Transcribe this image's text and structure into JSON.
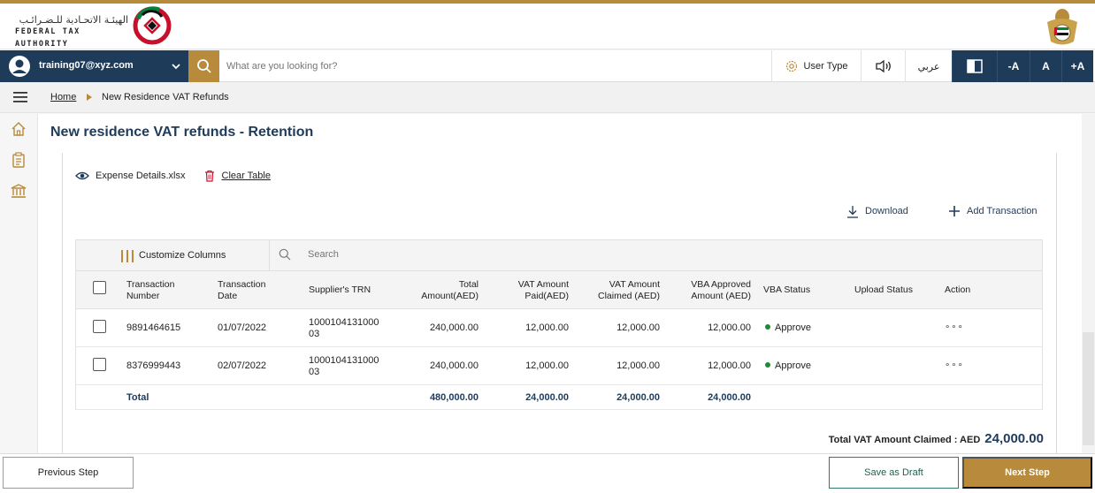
{
  "header": {
    "logo_ar": "الهيئـة الاتحـادية للـضـرائـب",
    "logo_en": "FEDERAL TAX AUTHORITY",
    "logo_icon": "fta-logo-mark",
    "emblem_icon": "uae-emblem"
  },
  "toolbar": {
    "user_email": "training07@xyz.com",
    "search_placeholder": "What are you looking for?",
    "user_type_label": "User Type",
    "language_label": "عربي",
    "font_decrease": "-A",
    "font_normal": "A",
    "font_increase": "+A"
  },
  "breadcrumb": {
    "home": "Home",
    "current": "New Residence VAT Refunds"
  },
  "page": {
    "title": "New residence VAT refunds - Retention",
    "file_name": "Expense Details.xlsx",
    "clear_table": "Clear Table",
    "download": "Download",
    "add_transaction": "Add Transaction"
  },
  "table": {
    "customize_columns": "Customize Columns",
    "search_placeholder": "Search",
    "headers": {
      "transaction_number": [
        "Transaction",
        "Number"
      ],
      "transaction_date": [
        "Transaction",
        "Date"
      ],
      "supplier_trn": "Supplier's TRN",
      "total_amount": [
        "Total",
        "Amount(AED)"
      ],
      "vat_paid": [
        "VAT Amount",
        "Paid(AED)"
      ],
      "vat_claimed": [
        "VAT Amount",
        "Claimed (AED)"
      ],
      "vba_approved": [
        "VBA Approved",
        "Amount (AED)"
      ],
      "vba_status": "VBA Status",
      "upload_status": "Upload Status",
      "action": "Action"
    },
    "rows": [
      {
        "transaction_number": "9891464615",
        "transaction_date": "01/07/2022",
        "supplier_trn": [
          "1000104131000",
          "03"
        ],
        "total_amount": "240,000.00",
        "vat_paid": "12,000.00",
        "vat_claimed": "12,000.00",
        "vba_approved": "12,000.00",
        "vba_status": "Approve",
        "action": "∘∘∘"
      },
      {
        "transaction_number": "8376999443",
        "transaction_date": "02/07/2022",
        "supplier_trn": [
          "1000104131000",
          "03"
        ],
        "total_amount": "240,000.00",
        "vat_paid": "12,000.00",
        "vat_claimed": "12,000.00",
        "vba_approved": "12,000.00",
        "vba_status": "Approve",
        "action": "∘∘∘"
      }
    ],
    "total": {
      "label": "Total",
      "total_amount": "480,000.00",
      "vat_paid": "24,000.00",
      "vat_claimed": "24,000.00",
      "vba_approved": "24,000.00"
    },
    "status_color": "#1b8a3a"
  },
  "summary": {
    "label": "Total VAT Amount Claimed : AED",
    "value": "24,000.00"
  },
  "footer": {
    "previous": "Previous Step",
    "save_draft": "Save as Draft",
    "next": "Next Step"
  },
  "colors": {
    "primary_navy": "#1f3b5a",
    "accent_gold": "#b88a3b"
  }
}
